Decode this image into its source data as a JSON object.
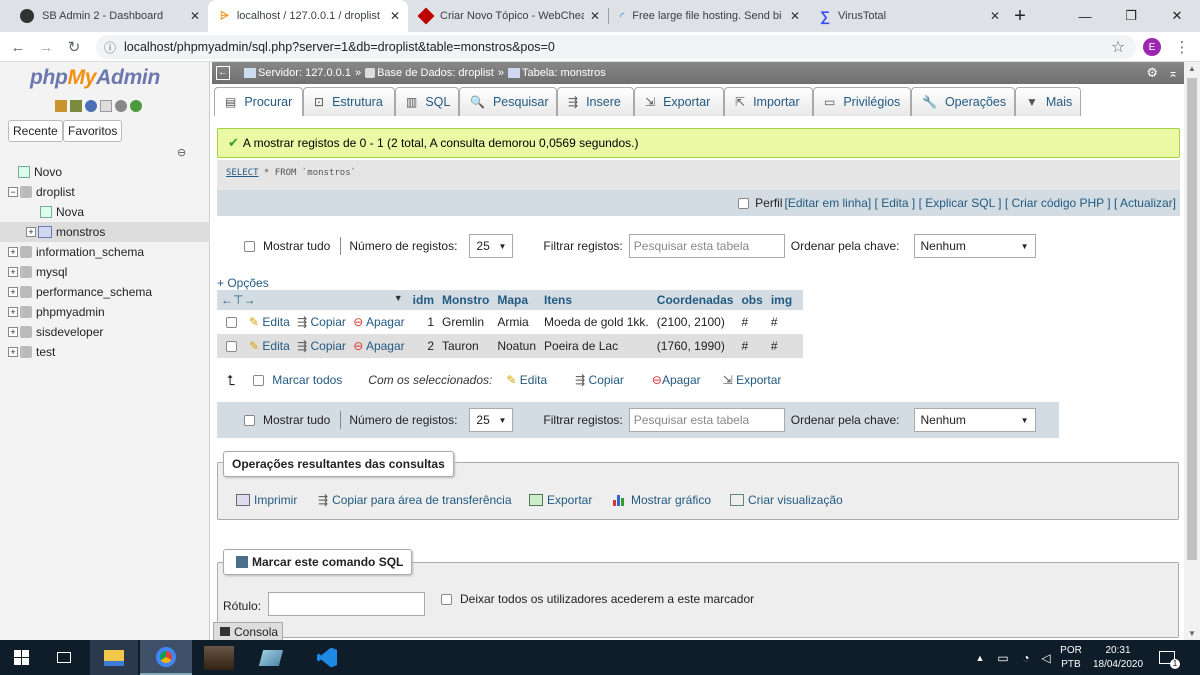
{
  "browser": {
    "tabs": [
      {
        "title": "SB Admin 2 - Dashboard"
      },
      {
        "title": "localhost / 127.0.0.1 / droplist"
      },
      {
        "title": "Criar Novo Tópico - WebCheat"
      },
      {
        "title": "Free large file hosting. Send bi"
      },
      {
        "title": "VirusTotal"
      }
    ],
    "url": "localhost/phpmyadmin/sql.php?server=1&db=droplist&table=monstros&pos=0",
    "profile_initial": "E"
  },
  "sidebar": {
    "logo_php": "php",
    "logo_my": "My",
    "logo_admin": "Admin",
    "recent": "Recente",
    "favorites": "Favoritos",
    "tree": [
      {
        "label": "Novo"
      },
      {
        "label": "droplist"
      },
      {
        "label": "Nova"
      },
      {
        "label": "monstros"
      },
      {
        "label": "information_schema"
      },
      {
        "label": "mysql"
      },
      {
        "label": "performance_schema"
      },
      {
        "label": "phpmyadmin"
      },
      {
        "label": "sisdeveloper"
      },
      {
        "label": "test"
      }
    ]
  },
  "breadcrumb": {
    "server": "Servidor: 127.0.0.1",
    "database": "Base de Dados: droplist",
    "table": "Tabela: monstros"
  },
  "main_tabs": [
    "Procurar",
    "Estrutura",
    "SQL",
    "Pesquisar",
    "Insere",
    "Exportar",
    "Importar",
    "Privilégios",
    "Operações",
    "Mais"
  ],
  "success_message": "A mostrar registos de 0 - 1 (2 total, A consulta demorou 0,0569 segundos.)",
  "sql": {
    "select": "SELECT",
    "rest": " * FROM `monstros`",
    "profile": "Perfil",
    "links": "[Editar em linha] [ Edita ] [ Explicar SQL ] [ Criar código PHP ] [ Actualizar]"
  },
  "nav": {
    "show_all": "Mostrar tudo",
    "rows_label": "Número de registos:",
    "rows_value": "25",
    "filter_label": "Filtrar registos:",
    "filter_placeholder": "Pesquisar esta tabela",
    "sort_label": "Ordenar pela chave:",
    "sort_value": "Nenhum"
  },
  "options_link": "+ Opções",
  "table": {
    "columns": [
      "idm",
      "Monstro",
      "Mapa",
      "Itens",
      "Coordenadas",
      "obs",
      "img"
    ],
    "actions": {
      "edit": "Edita",
      "copy": "Copiar",
      "delete": "Apagar"
    },
    "rows": [
      [
        "1",
        "Gremlin",
        "Armia",
        "Moeda de gold 1kk.",
        "(2100, 2100)",
        "#",
        "#"
      ],
      [
        "2",
        "Tauron",
        "Noatun",
        "Poeira de Lac",
        "(1760, 1990)",
        "#",
        "#"
      ]
    ]
  },
  "bulk": {
    "check_all": "Marcar todos",
    "with_selected": "Com os seleccionados:",
    "edit": "Edita",
    "copy": "Copiar",
    "delete": "Apagar",
    "export": "Exportar"
  },
  "query_ops": {
    "legend": "Operações resultantes das consultas",
    "print": "Imprimir",
    "copy_clipboard": "Copiar para área de transferência",
    "export": "Exportar",
    "chart": "Mostrar gráfico",
    "create_view": "Criar visualização"
  },
  "bookmark": {
    "legend": "Marcar este comando SQL",
    "label": "Rótulo:",
    "share": "Deixar todos os utilizadores acederem a este marcador"
  },
  "console": "Consola",
  "taskbar": {
    "lang1": "POR",
    "lang2": "PTB",
    "time": "20:31",
    "date": "18/04/2020",
    "notif_count": "1"
  }
}
